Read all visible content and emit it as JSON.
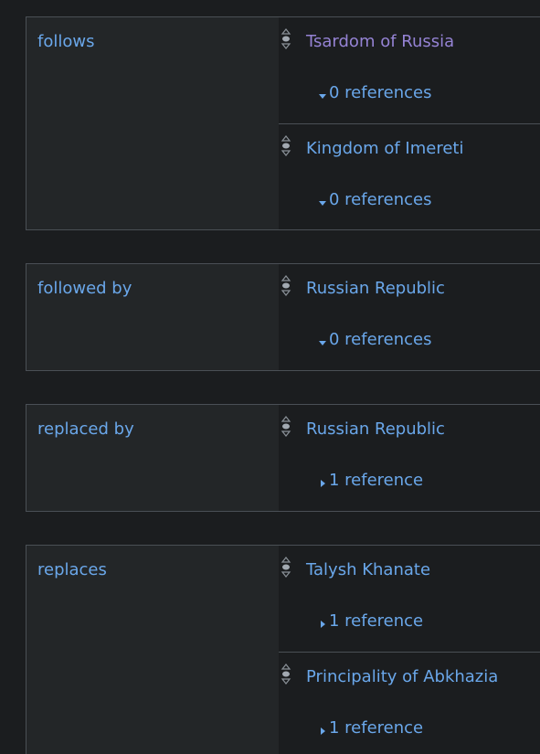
{
  "groups": [
    {
      "property": "follows",
      "statements": [
        {
          "value": "Tsardom of Russia",
          "visited": true,
          "references": "0 references",
          "expanded": true
        },
        {
          "value": "Kingdom of Imereti",
          "visited": false,
          "references": "0 references",
          "expanded": true
        }
      ]
    },
    {
      "property": "followed by",
      "statements": [
        {
          "value": "Russian Republic",
          "visited": false,
          "references": "0 references",
          "expanded": true
        }
      ]
    },
    {
      "property": "replaced by",
      "statements": [
        {
          "value": "Russian Republic",
          "visited": false,
          "references": "1 reference",
          "expanded": false
        }
      ]
    },
    {
      "property": "replaces",
      "statements": [
        {
          "value": "Talysh Khanate",
          "visited": false,
          "references": "1 reference",
          "expanded": false
        },
        {
          "value": "Principality of Abkhazia",
          "visited": false,
          "references": "1 reference",
          "expanded": false
        }
      ]
    }
  ],
  "colors": {
    "link": "#6aa7ea",
    "visited_link": "#9583d4",
    "background": "#1b1d1f",
    "property_background": "#232628",
    "border": "#4a4f55"
  }
}
